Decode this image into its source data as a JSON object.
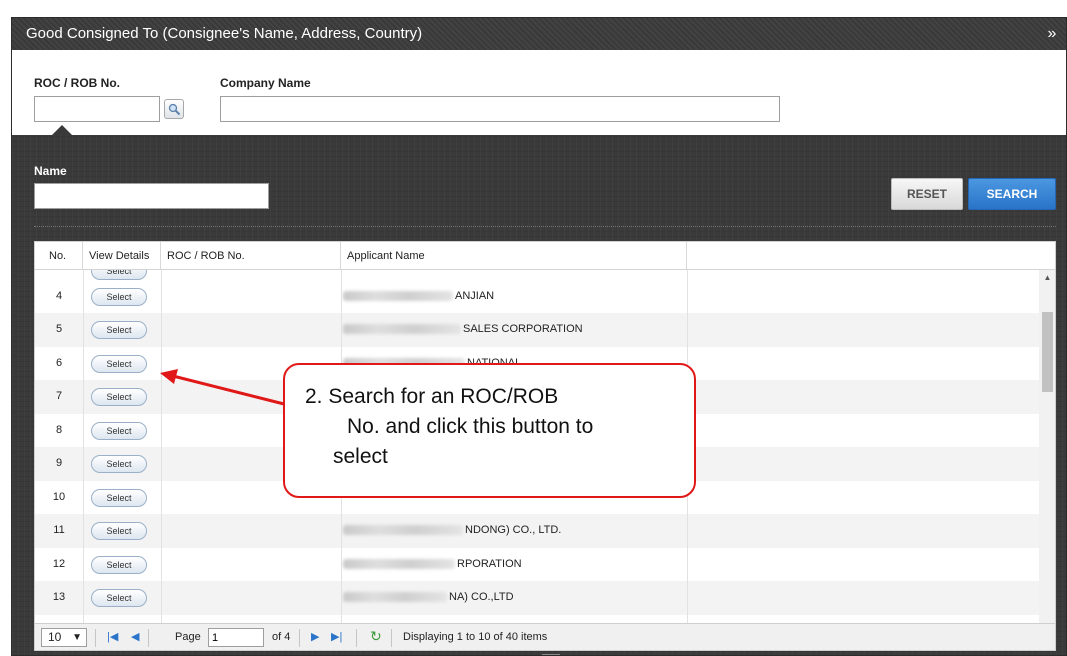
{
  "panel": {
    "title": "Good Consigned To (Consignee's Name, Address, Country)",
    "collapse_icon": "double-chevron-down-icon"
  },
  "top_form": {
    "roc_label": "ROC / ROB No.",
    "roc_value": "",
    "search_icon": "magnifier-icon",
    "company_label": "Company Name",
    "company_value": ""
  },
  "filter": {
    "name_label": "Name",
    "name_value": "",
    "reset_label": "RESET",
    "search_label": "SEARCH"
  },
  "grid": {
    "columns": [
      "No.",
      "View Details",
      "ROC / ROB No.",
      "Applicant Name"
    ],
    "rows": [
      {
        "no": "4",
        "action": "Select",
        "roc": "",
        "applicant": "ANJIAN"
      },
      {
        "no": "5",
        "action": "Select",
        "roc": "",
        "applicant": "SALES CORPORATION"
      },
      {
        "no": "6",
        "action": "Select",
        "roc": "",
        "applicant": "NATIONAL"
      },
      {
        "no": "7",
        "action": "Select",
        "roc": "",
        "applicant": ""
      },
      {
        "no": "8",
        "action": "Select",
        "roc": "",
        "applicant": ""
      },
      {
        "no": "9",
        "action": "Select",
        "roc": "",
        "applicant": ""
      },
      {
        "no": "10",
        "action": "Select",
        "roc": "",
        "applicant": ""
      },
      {
        "no": "11",
        "action": "Select",
        "roc": "",
        "applicant": "NDONG) CO., LTD."
      },
      {
        "no": "12",
        "action": "Select",
        "roc": "",
        "applicant": "RPORATION"
      },
      {
        "no": "13",
        "action": "Select",
        "roc": "",
        "applicant": "NA) CO.,LTD"
      }
    ]
  },
  "pager": {
    "page_size": "10",
    "page_label": "Page",
    "page_value": "1",
    "of_label": "of 4",
    "display_text": "Displaying 1 to 10 of 40 items",
    "icons": [
      "first-page-icon",
      "prev-page-icon",
      "next-page-icon",
      "last-page-icon",
      "refresh-icon"
    ]
  },
  "annotation": {
    "line1": "2. Search for an ROC/ROB",
    "line2": "No. and click this button to",
    "line3": "select",
    "color": "#e11818"
  }
}
